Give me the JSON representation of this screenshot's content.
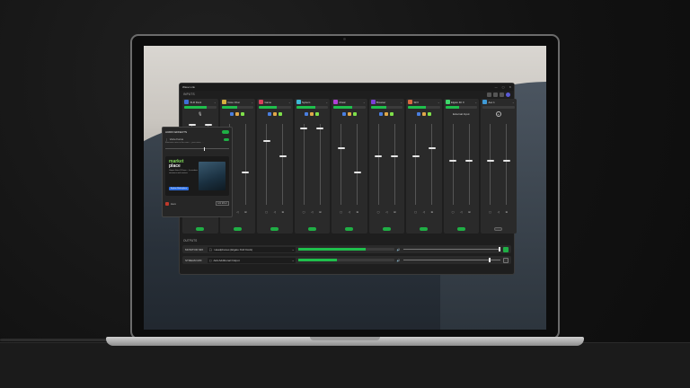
{
  "window": {
    "title": "Wave Link",
    "controls": [
      "—",
      "▢",
      "✕"
    ]
  },
  "sections": {
    "inputs": "INPUTS",
    "outputs": "OUTPUTS"
  },
  "channels": [
    {
      "name": "XLR Dock",
      "color": "#3f6fd6",
      "meter": 0.7,
      "apps": "",
      "icon": "mic-icon",
      "f1": 0.0,
      "f2": 0.0,
      "labels": [
        "▢",
        "◁",
        "⊞"
      ]
    },
    {
      "name": "Voice Chat",
      "color": "#d6b13f",
      "meter": 0.5,
      "apps": "",
      "f1": 0.6,
      "f2": 0.6,
      "labels": [
        "▢",
        "◁",
        "⊞"
      ]
    },
    {
      "name": "Game",
      "color": "#d63f5a",
      "meter": 0.55,
      "apps": "",
      "f1": 0.2,
      "f2": 0.4,
      "labels": [
        "▢",
        "◁",
        "⊞"
      ]
    },
    {
      "name": "System",
      "color": "#3fb8d6",
      "meter": 0.6,
      "apps": "",
      "f1": 0.05,
      "f2": 0.05,
      "labels": [
        "▢",
        "◁",
        "⊞"
      ]
    },
    {
      "name": "Music",
      "color": "#b03fd6",
      "meter": 0.6,
      "apps": "",
      "f1": 0.3,
      "f2": 0.6,
      "labels": [
        "▢",
        "◁",
        "⊞"
      ]
    },
    {
      "name": "Browser",
      "color": "#7b3fd6",
      "meter": 0.5,
      "apps": "",
      "f1": 0.4,
      "f2": 0.4,
      "labels": [
        "▢",
        "◁",
        "⊞"
      ]
    },
    {
      "name": "SFX",
      "color": "#d66a3f",
      "meter": 0.55,
      "apps": "",
      "f1": 0.4,
      "f2": 0.3,
      "labels": [
        "▢",
        "◁",
        "⊞"
      ]
    },
    {
      "name": "Elgato 4K X",
      "color": "#3fd66a",
      "meter": 0.45,
      "apps": "External Input",
      "f1": 0.45,
      "f2": 0.45,
      "labels": [
        "▢",
        "◁",
        "⊞"
      ]
    },
    {
      "name": "Aux 1",
      "color": "#3f9ad6",
      "meter": 0.0,
      "apps": "",
      "f1": 0.45,
      "f2": 0.45,
      "labels": [
        "▢",
        "◁",
        "⊞"
      ]
    }
  ],
  "outputs": [
    {
      "name": "MONITOR MIX",
      "device": "Headphones (Elgato XLR Dock)",
      "meter": 0.7,
      "level": 0.98,
      "on": true
    },
    {
      "name": "STREAM MIX",
      "device": "Add Additional Output",
      "meter": 0.4,
      "level": 0.88,
      "on": false
    }
  ],
  "effects": {
    "title": "AUDIO EFFECTS",
    "plugin_name": "Voice Focus",
    "plugin_desc": "Eliminate noise in the room ... your voice, ...",
    "ad_logo_1": "market",
    "ad_logo_2": "place",
    "ad_text": "Unique Voice FX from ... for modern streamers and creators.",
    "ad_button": "Explore Marketplace",
    "footer_label": "Hero",
    "add_button": "Add Effect"
  }
}
